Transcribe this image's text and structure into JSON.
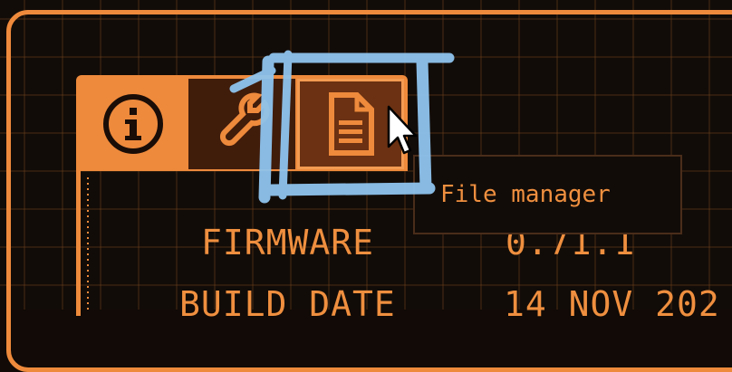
{
  "tabs": [
    {
      "id": "info",
      "icon": "info-icon",
      "state": "inactive"
    },
    {
      "id": "tools",
      "icon": "wrench-icon",
      "state": "active"
    },
    {
      "id": "files",
      "icon": "document-icon",
      "state": "hovered"
    }
  ],
  "tooltip": {
    "text": "File manager"
  },
  "info": {
    "rows": [
      {
        "label": "FIRMWARE",
        "value": "0.71.1"
      },
      {
        "label": "BUILD DATE",
        "value": "14 NOV 202"
      }
    ]
  },
  "colors": {
    "accent": "#ee8a3c",
    "background": "#120c08",
    "tab_active": "#401c0b",
    "tab_hover": "#6b3112",
    "highlight": "#8fc4ee"
  }
}
